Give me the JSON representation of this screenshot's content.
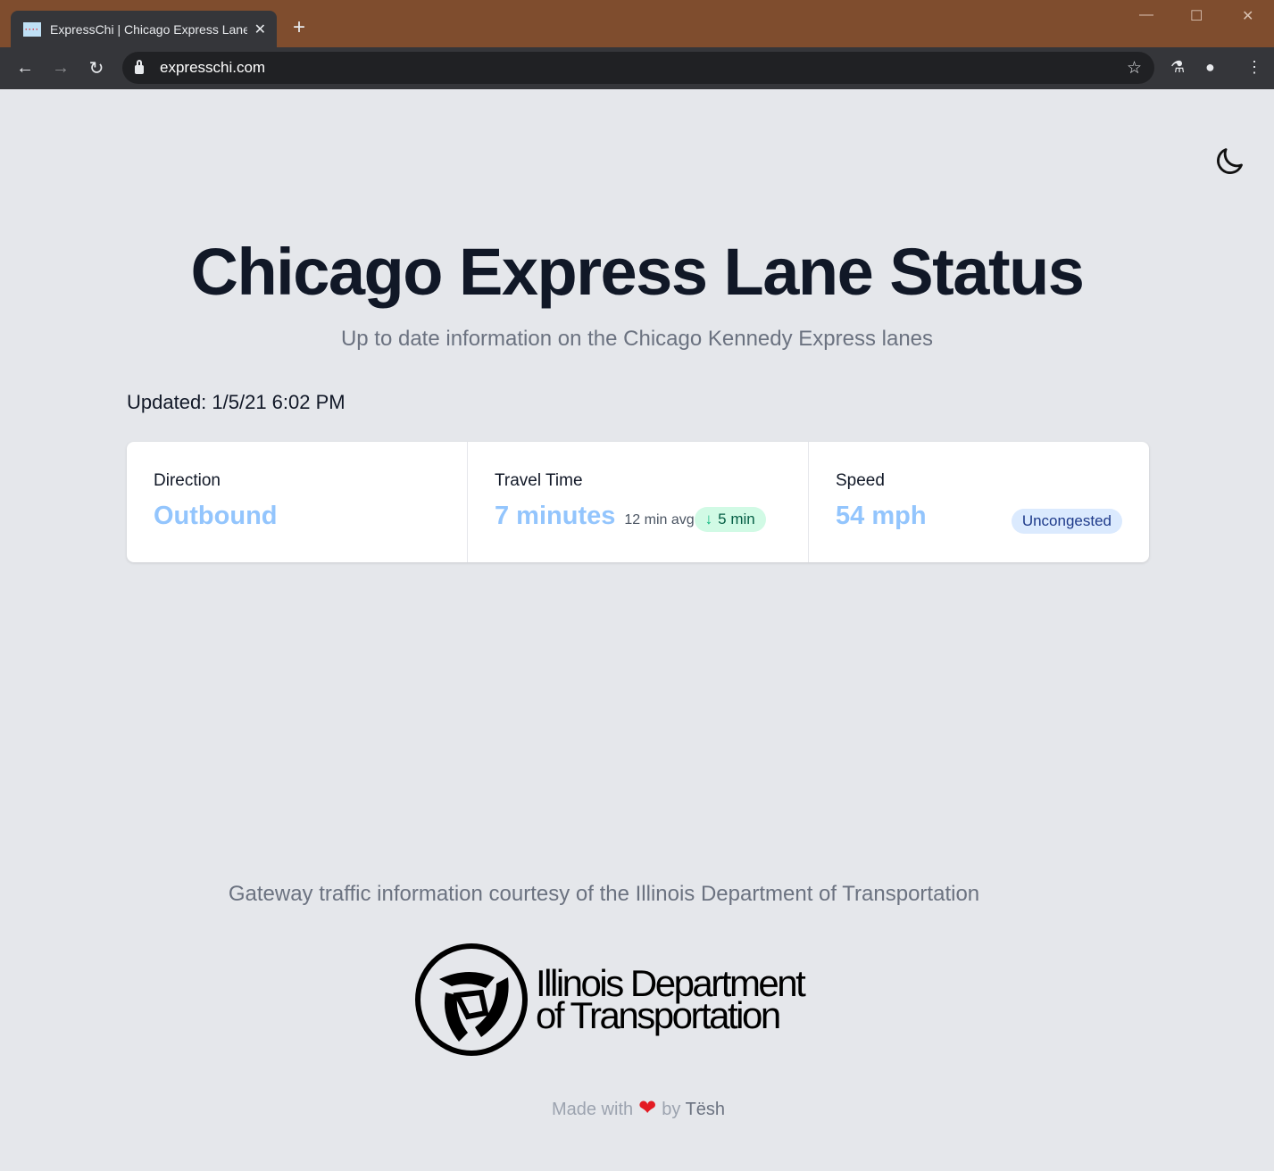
{
  "browser": {
    "tab_title": "ExpressChi | Chicago Express Lane",
    "url": "expresschi.com",
    "frame_color": "#7f4d2e"
  },
  "page": {
    "title": "Chicago Express Lane Status",
    "subtitle": "Up to date information on the Chicago Kennedy Express lanes",
    "updated": "Updated: 1/5/21 6:02 PM",
    "theme_toggle_icon": "moon-icon",
    "stats": {
      "direction": {
        "label": "Direction",
        "value": "Outbound"
      },
      "travel_time": {
        "label": "Travel Time",
        "value": "7 minutes",
        "avg": "12 min avg",
        "change": "5 min",
        "change_direction": "down"
      },
      "speed": {
        "label": "Speed",
        "value": "54 mph",
        "status": "Uncongested"
      }
    },
    "courtesy": "Gateway traffic information courtesy of the Illinois Department of Transportation",
    "logo_text_line1": "Illinois Department",
    "logo_text_line2": "of Transportation",
    "footer": {
      "made_with": "Made with",
      "by": "by",
      "author": "Tësh"
    }
  },
  "colors": {
    "accent": "#93c5fd",
    "background": "#e5e7eb",
    "positive": "#10b981"
  }
}
